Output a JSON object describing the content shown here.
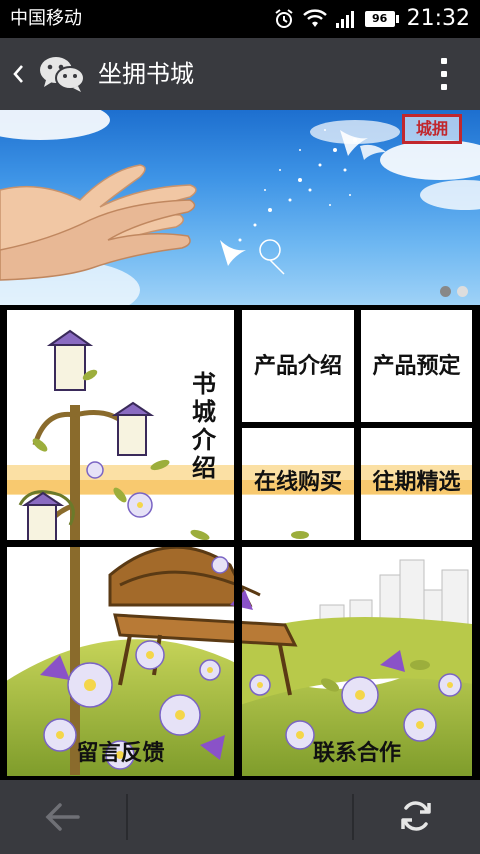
{
  "status_bar": {
    "carrier": "中国移动",
    "battery_level": "96",
    "time": "21:32",
    "icons": [
      "alarm-icon",
      "wifi-icon",
      "signal-icon",
      "battery-icon"
    ]
  },
  "header": {
    "title": "坐拥书城",
    "back_icon": "chevron-left-icon",
    "logo_icon": "wechat-icon",
    "menu_icon": "more-vertical-icon"
  },
  "banner": {
    "stamp_text": "城拥",
    "page_count": 2,
    "active_page": 2
  },
  "tiles": {
    "book_intro": "书城介绍",
    "book_intro_chars": [
      "书",
      "城",
      "介",
      "绍"
    ],
    "product_intro": "产品介绍",
    "product_order": "产品预定",
    "buy_online": "在线购买",
    "past_picks": "往期精选",
    "feedback": "留言反馈",
    "contact": "联系合作"
  },
  "bottom_bar": {
    "back_icon": "arrow-left-icon",
    "refresh_icon": "refresh-icon"
  },
  "colors": {
    "bar": "#393a3f",
    "status_bar": "#000000",
    "sky": "#3e94e6",
    "stamp": "#c1272d"
  }
}
